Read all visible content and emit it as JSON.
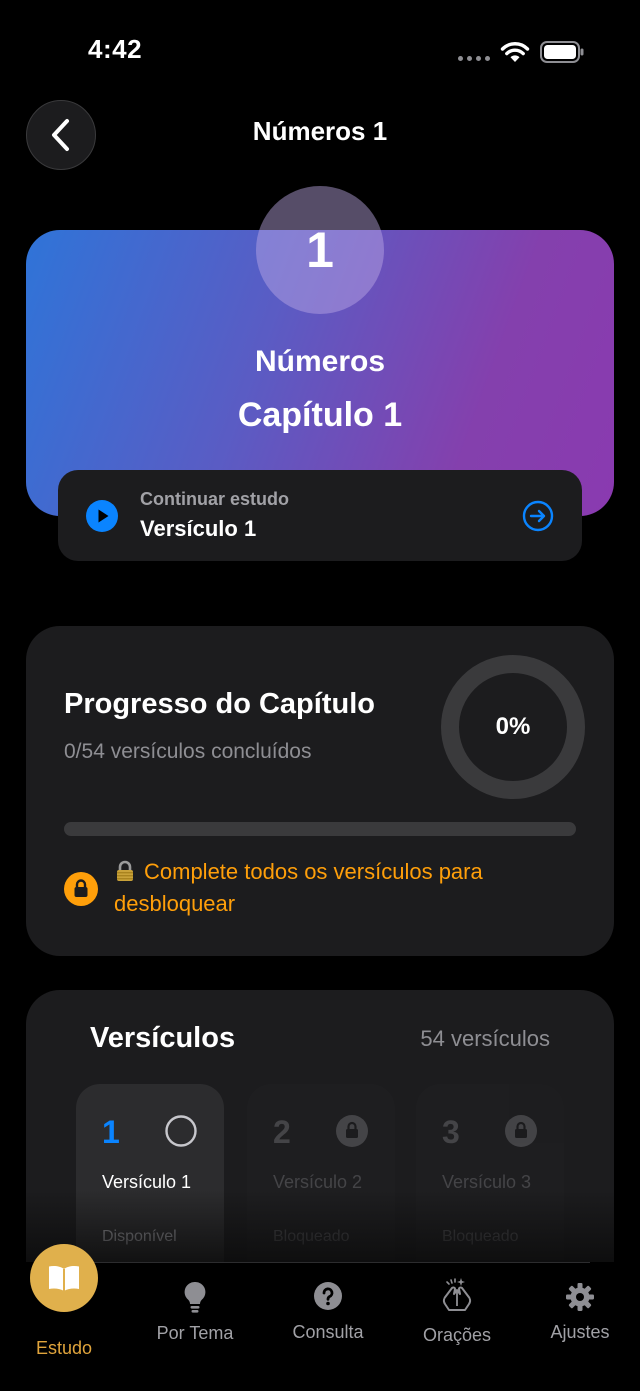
{
  "status_bar": {
    "time": "4:42"
  },
  "header": {
    "title": "Números 1"
  },
  "hero": {
    "chapter_number": "1",
    "book": "Números",
    "chapter_label": "Capítulo 1",
    "continue_caption": "Continuar estudo",
    "continue_verse": "Versículo 1"
  },
  "progress": {
    "title": "Progresso do Capítulo",
    "subtitle": "0/54 versículos concluídos",
    "percent_label": "0%",
    "fraction": 0,
    "lock_message": "Complete todos os versículos para desbloquear"
  },
  "verses": {
    "title": "Versículos",
    "count_label": "54 versículos",
    "items": [
      {
        "number": "1",
        "label": "Versículo 1",
        "status": "Disponível",
        "state": "available"
      },
      {
        "number": "2",
        "label": "Versículo 2",
        "status": "Bloqueado",
        "state": "locked"
      },
      {
        "number": "3",
        "label": "Versículo 3",
        "status": "Bloqueado",
        "state": "locked"
      }
    ]
  },
  "tabs": [
    {
      "label": "Estudo",
      "icon": "book-icon",
      "active": true
    },
    {
      "label": "Por Tema",
      "icon": "lightbulb-icon",
      "active": false
    },
    {
      "label": "Consulta",
      "icon": "question-icon",
      "active": false
    },
    {
      "label": "Orações",
      "icon": "praying-hands-icon",
      "active": false
    },
    {
      "label": "Ajustes",
      "icon": "gear-icon",
      "active": false
    }
  ],
  "colors": {
    "accent_blue": "#0a84ff",
    "warning_orange": "#ff9f0a",
    "active_tab": "#e0b04c",
    "hero_gradient_start": "#2f74d8",
    "hero_gradient_end": "#8a3ab0"
  }
}
